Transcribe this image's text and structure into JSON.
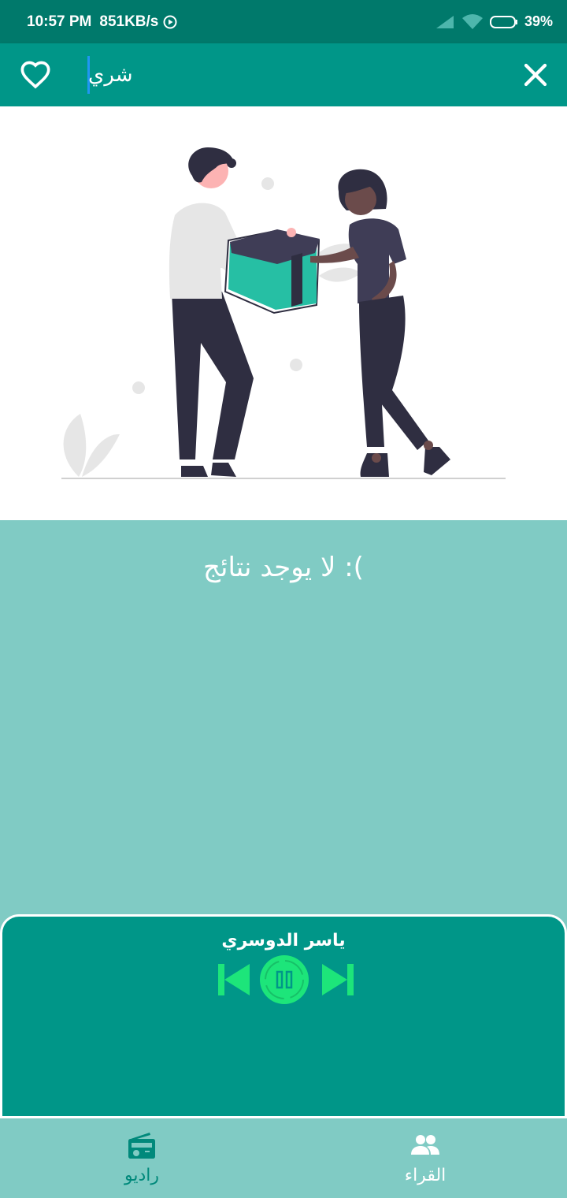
{
  "status_bar": {
    "time": "10:57 PM",
    "speed": "851KB/s",
    "battery": "39%"
  },
  "search": {
    "value": "شري",
    "placeholder": ""
  },
  "icons": {
    "favorite": "heart-outline-icon",
    "close": "close-icon",
    "prev": "skip-previous-icon",
    "play": "pause-icon",
    "next": "skip-next-icon",
    "radio": "radio-icon",
    "readers": "people-icon"
  },
  "main": {
    "empty_message": "لا يوجد نتائج :("
  },
  "player": {
    "reciter_name": "ياسر الدوسري"
  },
  "bottom_nav": {
    "items": [
      {
        "label": "راديو",
        "active": true
      },
      {
        "label": "القراء",
        "active": false
      }
    ]
  },
  "colors": {
    "status_bar": "#00796b",
    "primary": "#009688",
    "background": "#80cbc4",
    "player_controls": "#1de57a",
    "active_nav": "#00897b"
  }
}
